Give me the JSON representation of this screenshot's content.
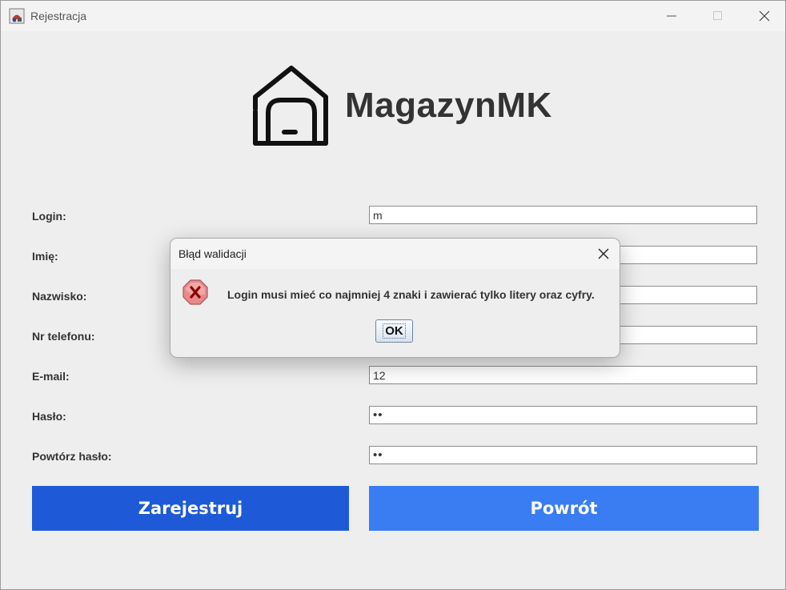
{
  "window": {
    "title": "Rejestracja"
  },
  "header": {
    "brand": "MagazynMK",
    "logo_icon": "warehouse-icon"
  },
  "form": {
    "labels": {
      "login": "Login:",
      "first_name": "Imię:",
      "last_name": "Nazwisko:",
      "phone": "Nr telefonu:",
      "email": "E-mail:",
      "password": "Hasło:",
      "repeat_password": "Powtórz hasło:"
    },
    "values": {
      "login": "m",
      "first_name": "",
      "last_name": "",
      "phone": "",
      "email": "12",
      "password": "••",
      "repeat_password": "••"
    }
  },
  "buttons": {
    "register": "Zarejestruj",
    "back": "Powrót"
  },
  "dialog": {
    "title": "Błąd walidacji",
    "message": "Login musi mieć co najmniej 4 znaki i zawierać tylko litery oraz cyfry.",
    "ok": "OK",
    "icon": "error-icon"
  },
  "colors": {
    "register_button": "#1e5ad7",
    "back_button": "#3a7cf2",
    "error_icon": "#e8898c"
  }
}
